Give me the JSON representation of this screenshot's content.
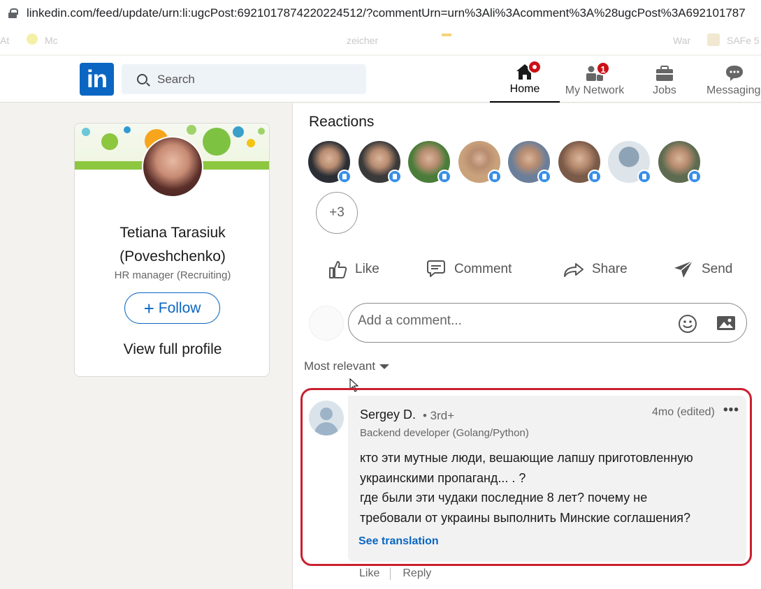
{
  "browser": {
    "url": "linkedin.com/feed/update/urn:li:ugcPost:6921017874220224512/?commentUrn=urn%3Ali%3Acomment%3A%28ugcPost%3A692101787"
  },
  "bookmarks": [
    "At",
    "Mc",
    "zeicher",
    "War",
    "SAFe 5"
  ],
  "header": {
    "search_placeholder": "Search",
    "nav": [
      {
        "label": "Home",
        "badge": "",
        "active": true
      },
      {
        "label": "My Network",
        "badge": "1"
      },
      {
        "label": "Jobs",
        "badge": ""
      },
      {
        "label": "Messaging",
        "badge": ""
      }
    ]
  },
  "profile": {
    "name": "Tetiana Tarasiuk (Poveshchenko)",
    "title": "HR manager (Recruiting)",
    "follow_label": "Follow",
    "view_full": "View full profile"
  },
  "reactions": {
    "title": "Reactions",
    "more": "+3",
    "avatar_colors": [
      "#2b2f35",
      "#3a3a3a",
      "#4a7d3a",
      "#c9a27c",
      "#6b7f9a",
      "#7a5a48",
      "#c8d3dc",
      "#5d6b50"
    ]
  },
  "actions": [
    "Like",
    "Comment",
    "Share",
    "Send"
  ],
  "comment_input": {
    "placeholder": "Add a comment..."
  },
  "sort": {
    "label": "Most relevant"
  },
  "comment": {
    "author": "Sergey D.",
    "degree": "• 3rd+",
    "headline": "Backend developer (Golang/Python)",
    "time": "4mo (edited)",
    "more": "•••",
    "lines": [
      "кто эти мутные люди, вешающие лапшу приготовленную",
      "украинскими пропаганд... . ?",
      "где были эти чудаки последние 8 лет? почему не",
      "требовали от украины выполнить Минские соглашения?"
    ],
    "see_translation": "See translation",
    "like": "Like",
    "reply": "Reply"
  },
  "colors": {
    "brand": "#0a66c2",
    "highlight_frame": "#c8202f",
    "badge": "#cc1016"
  }
}
